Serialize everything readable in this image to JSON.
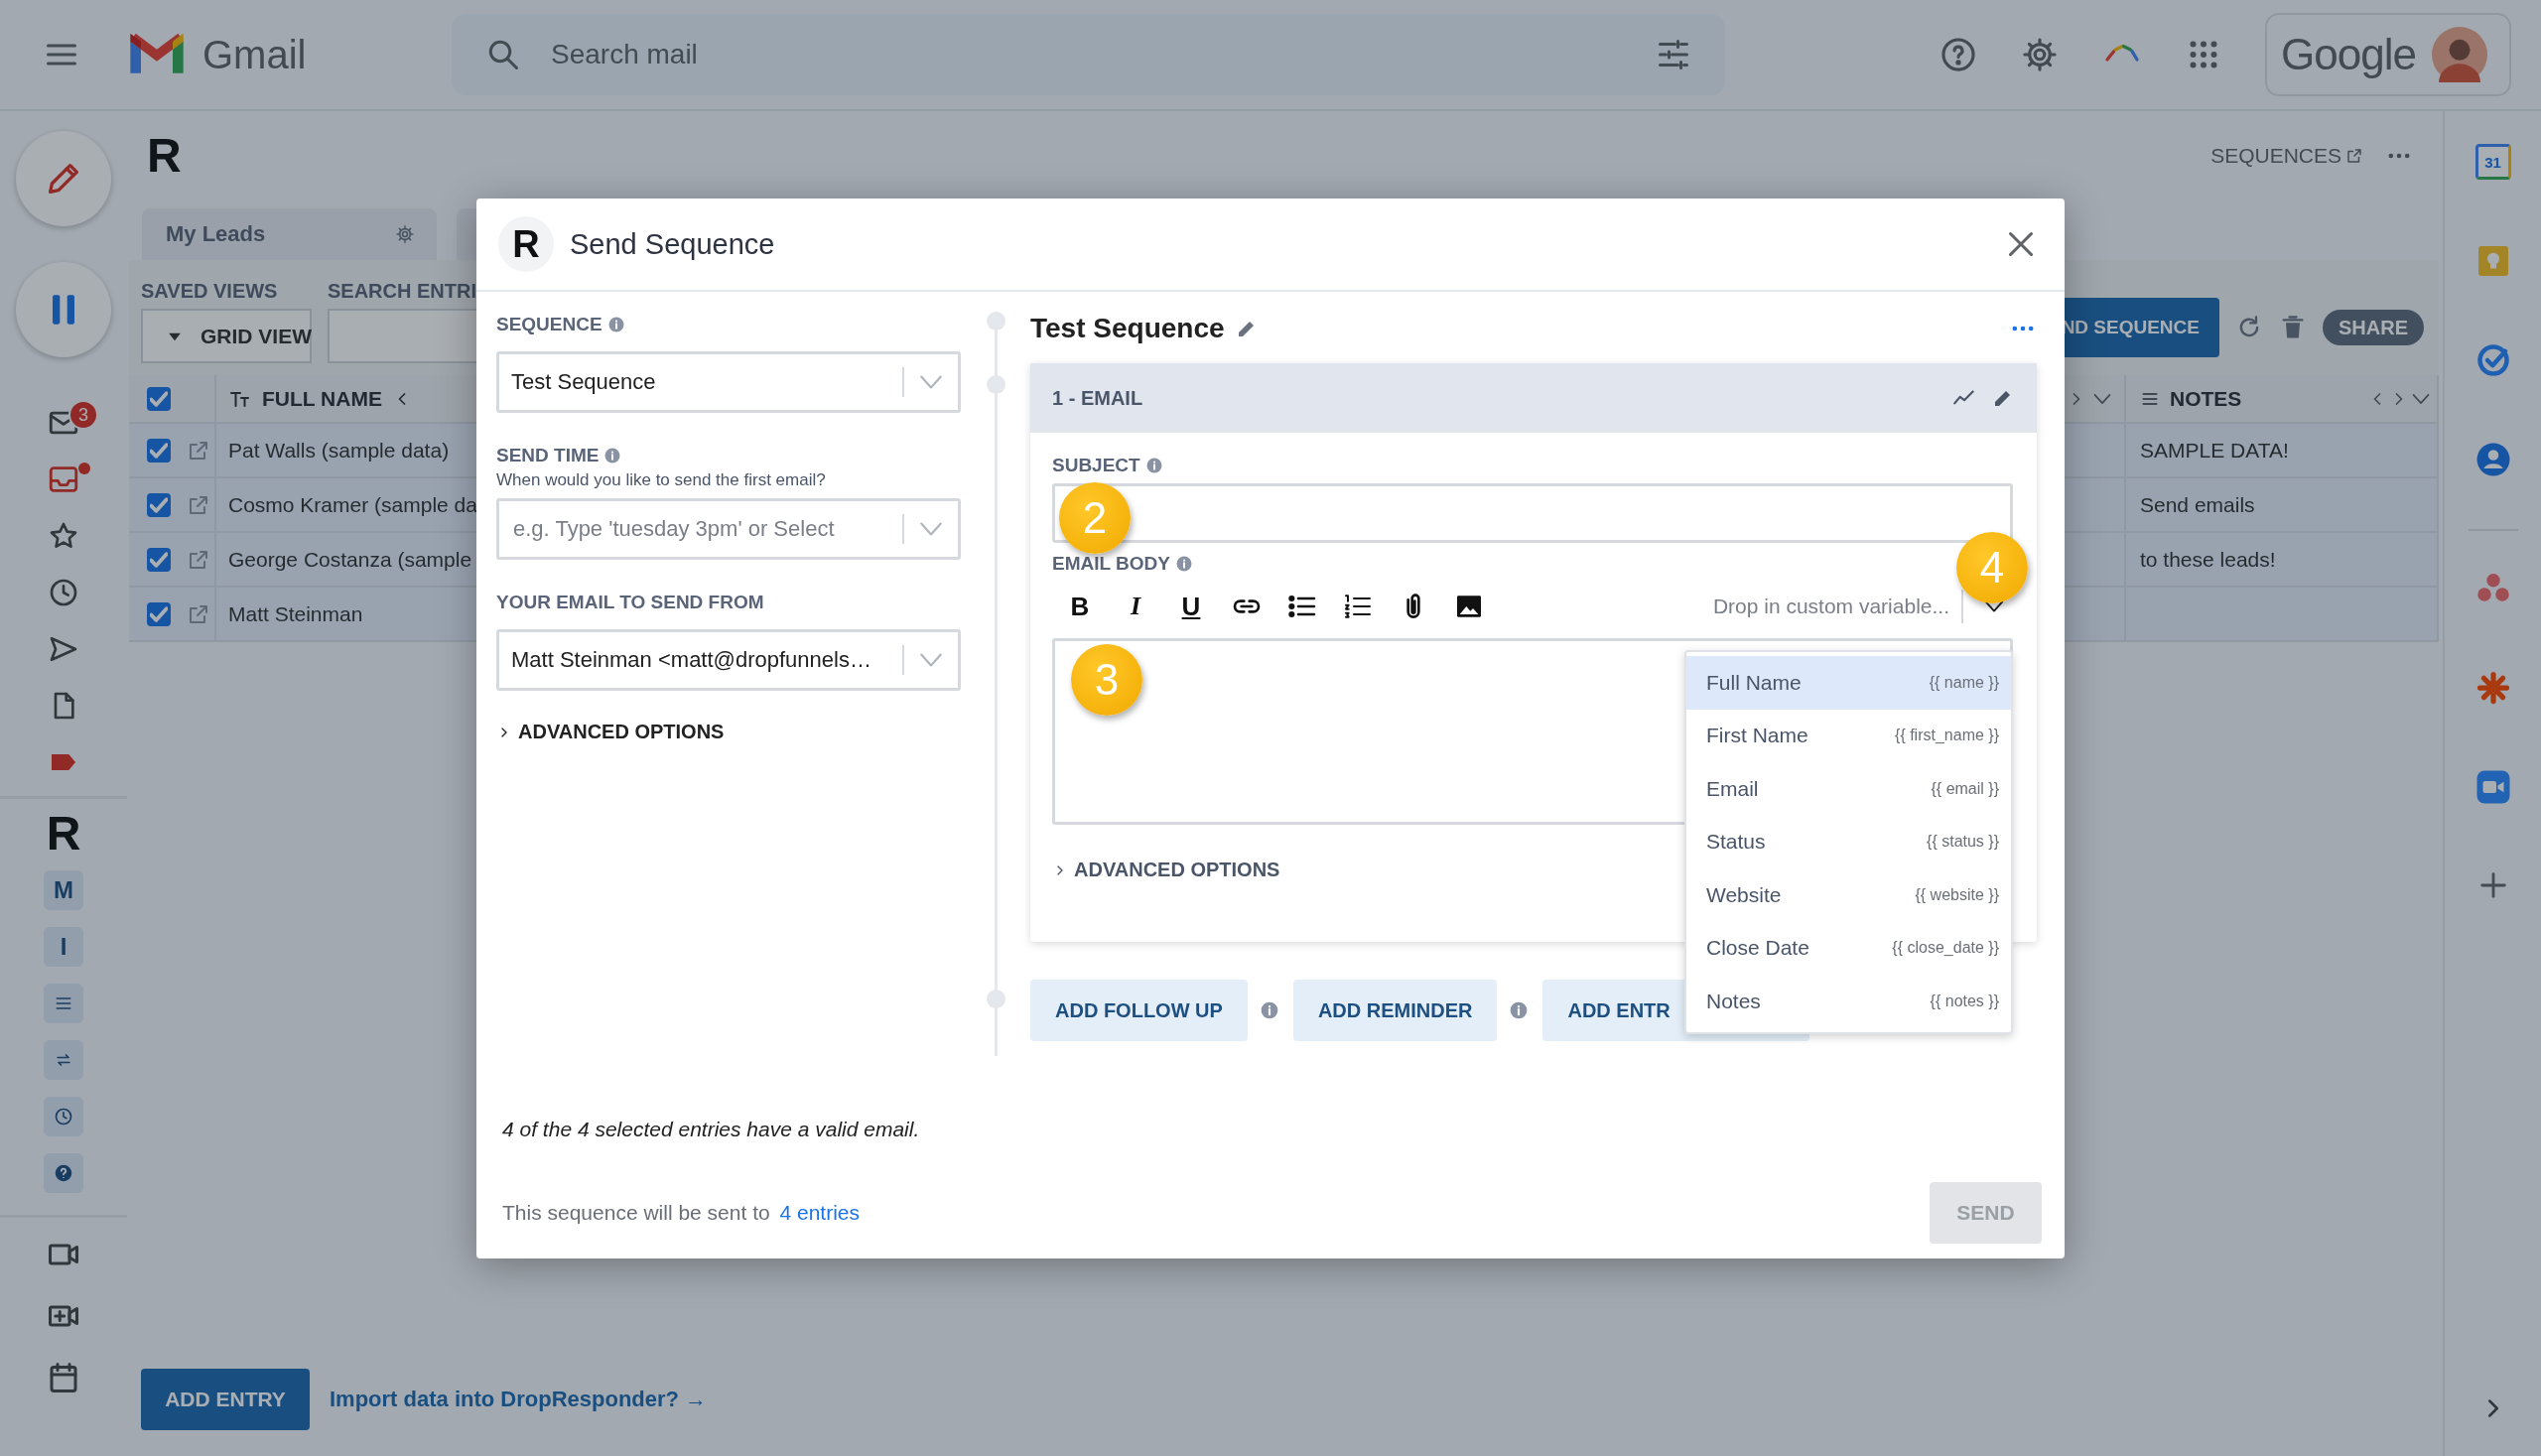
{
  "gmail": {
    "app_name": "Gmail",
    "search": {
      "placeholder": "Search mail"
    },
    "account_label": "Google"
  },
  "left_rail": {
    "mail_badge": "3",
    "app_marks": [
      {
        "kind": "logo",
        "text": "R"
      },
      {
        "kind": "letter",
        "text": "M"
      },
      {
        "kind": "letter",
        "text": "I"
      },
      {
        "kind": "lines"
      },
      {
        "kind": "swap"
      },
      {
        "kind": "clock"
      },
      {
        "kind": "help"
      }
    ]
  },
  "right_rail": {
    "calendar_day": "31"
  },
  "addon": {
    "logo": "R",
    "sequences_link": "SEQUENCES",
    "tab": "My Leads",
    "saved_views_label": "SAVED VIEWS",
    "view_button": "GRID VIEW",
    "search_label": "SEARCH ENTRI",
    "send_sequence_button": "ND SEQUENCE",
    "share_button": "SHARE",
    "table": {
      "header_checked": true,
      "name_column": "FULL NAME",
      "notes_column": "NOTES",
      "rows": [
        {
          "checked": true,
          "name": "Pat Walls (sample data)",
          "notes": "SAMPLE DATA!"
        },
        {
          "checked": true,
          "name": "Cosmo Kramer (sample da",
          "notes": "Send emails"
        },
        {
          "checked": true,
          "name": "George Costanza (sample",
          "notes": "to these leads!"
        },
        {
          "checked": true,
          "name": "Matt Steinman"
        }
      ]
    },
    "add_entry_button": "ADD ENTRY",
    "import_link": "Import data into DropResponder? →"
  },
  "modal": {
    "logo": "R",
    "title": "Send Sequence",
    "fields": [
      {
        "kind": "select",
        "label": "SEQUENCE",
        "info": true,
        "value": "Test Sequence"
      },
      {
        "kind": "combo",
        "label": "SEND TIME",
        "info": true,
        "hint": "When would you like to send the first email?",
        "placeholder": "e.g. Type 'tuesday 3pm' or Select"
      },
      {
        "kind": "select",
        "label": "YOUR EMAIL TO SEND FROM",
        "info": false,
        "value": "Matt Steinman <matt@dropfunnels…"
      }
    ],
    "advanced": "ADVANCED OPTIONS",
    "sequence_name": "Test Sequence",
    "step": {
      "title": "1 - EMAIL",
      "subject_label": "SUBJECT",
      "body_label": "EMAIL BODY",
      "format_buttons": [
        "B",
        "I",
        "U"
      ],
      "variable_placeholder": "Drop in custom variable...",
      "advanced": "ADVANCED OPTIONS"
    },
    "variables": [
      {
        "label": "Full Name",
        "token": "{{ name }}",
        "selected": true
      },
      {
        "label": "First Name",
        "token": "{{ first_name }}",
        "selected": false
      },
      {
        "label": "Email",
        "token": "{{ email }}",
        "selected": false
      },
      {
        "label": "Status",
        "token": "{{ status }}",
        "selected": false
      },
      {
        "label": "Website",
        "token": "{{ website }}",
        "selected": false
      },
      {
        "label": "Close Date",
        "token": "{{ close_date }}",
        "selected": false
      },
      {
        "label": "Notes",
        "token": "{{ notes }}",
        "selected": false
      }
    ],
    "actions": [
      "ADD FOLLOW UP",
      "ADD REMINDER",
      "ADD ENTR"
    ],
    "valid_note": "4 of the 4 selected entries have a valid email.",
    "summary": {
      "text": "This sequence will be sent to",
      "link": "4 entries"
    },
    "send_button": {
      "label": "SEND",
      "disabled": true
    }
  },
  "callouts": [
    "2",
    "3",
    "4"
  ]
}
